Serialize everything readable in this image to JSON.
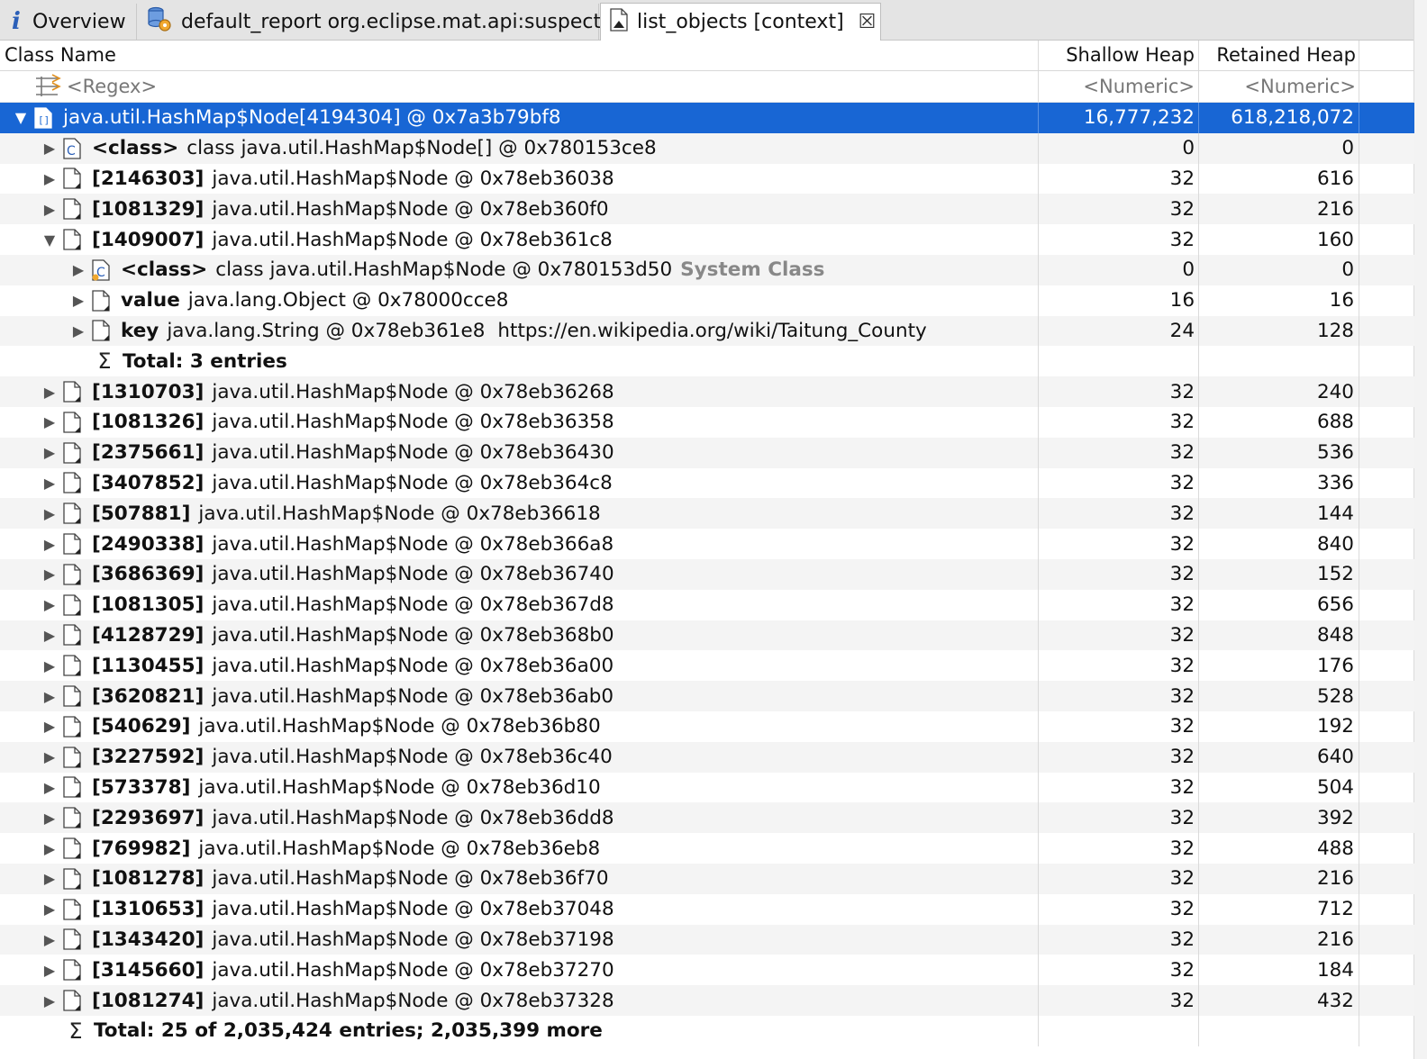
{
  "tabs": [
    {
      "label": "Overview",
      "icon": "info-icon"
    },
    {
      "label": "default_report  org.eclipse.mat.api:suspects",
      "icon": "report-icon"
    },
    {
      "label": "list_objects [context]",
      "icon": "document-icon",
      "close": "☒"
    }
  ],
  "columns": {
    "class_name": "Class Name",
    "shallow": "Shallow Heap",
    "retained": "Retained Heap"
  },
  "filter": {
    "regex": "<Regex>",
    "shallow": "<Numeric>",
    "retained": "<Numeric>"
  },
  "root": {
    "name": "java.util.HashMap$Node[4194304] @ 0x7a3b79bf8",
    "shallow": "16,777,232",
    "retained": "618,218,072"
  },
  "class_row": {
    "bold": "<class>",
    "text": "class java.util.HashMap$Node[] @ 0x780153ce8",
    "shallow": "0",
    "retained": "0"
  },
  "rows_before": [
    {
      "idx": "[2146303]",
      "text": "java.util.HashMap$Node @ 0x78eb36038",
      "shallow": "32",
      "retained": "616"
    },
    {
      "idx": "[1081329]",
      "text": "java.util.HashMap$Node @ 0x78eb360f0",
      "shallow": "32",
      "retained": "216"
    }
  ],
  "expanded": {
    "idx": "[1409007]",
    "text": "java.util.HashMap$Node @ 0x78eb361c8",
    "shallow": "32",
    "retained": "160"
  },
  "children": [
    {
      "bold": "<class>",
      "text": "class java.util.HashMap$Node @ 0x780153d50",
      "extra": "System Class",
      "shallow": "0",
      "retained": "0"
    },
    {
      "bold": "value",
      "text": "java.lang.Object @ 0x78000cce8",
      "extra": "",
      "shallow": "16",
      "retained": "16"
    },
    {
      "bold": "key",
      "text": "java.lang.String @ 0x78eb361e8",
      "extra": "https://en.wikipedia.org/wiki/Taitung_County",
      "shallow": "24",
      "retained": "128"
    }
  ],
  "child_total": "Total: 3 entries",
  "rows_after": [
    {
      "idx": "[1310703]",
      "text": "java.util.HashMap$Node @ 0x78eb36268",
      "shallow": "32",
      "retained": "240"
    },
    {
      "idx": "[1081326]",
      "text": "java.util.HashMap$Node @ 0x78eb36358",
      "shallow": "32",
      "retained": "688"
    },
    {
      "idx": "[2375661]",
      "text": "java.util.HashMap$Node @ 0x78eb36430",
      "shallow": "32",
      "retained": "536"
    },
    {
      "idx": "[3407852]",
      "text": "java.util.HashMap$Node @ 0x78eb364c8",
      "shallow": "32",
      "retained": "336"
    },
    {
      "idx": "[507881]",
      "text": "java.util.HashMap$Node @ 0x78eb36618",
      "shallow": "32",
      "retained": "144"
    },
    {
      "idx": "[2490338]",
      "text": "java.util.HashMap$Node @ 0x78eb366a8",
      "shallow": "32",
      "retained": "840"
    },
    {
      "idx": "[3686369]",
      "text": "java.util.HashMap$Node @ 0x78eb36740",
      "shallow": "32",
      "retained": "152"
    },
    {
      "idx": "[1081305]",
      "text": "java.util.HashMap$Node @ 0x78eb367d8",
      "shallow": "32",
      "retained": "656"
    },
    {
      "idx": "[4128729]",
      "text": "java.util.HashMap$Node @ 0x78eb368b0",
      "shallow": "32",
      "retained": "848"
    },
    {
      "idx": "[1130455]",
      "text": "java.util.HashMap$Node @ 0x78eb36a00",
      "shallow": "32",
      "retained": "176"
    },
    {
      "idx": "[3620821]",
      "text": "java.util.HashMap$Node @ 0x78eb36ab0",
      "shallow": "32",
      "retained": "528"
    },
    {
      "idx": "[540629]",
      "text": "java.util.HashMap$Node @ 0x78eb36b80",
      "shallow": "32",
      "retained": "192"
    },
    {
      "idx": "[3227592]",
      "text": "java.util.HashMap$Node @ 0x78eb36c40",
      "shallow": "32",
      "retained": "640"
    },
    {
      "idx": "[573378]",
      "text": "java.util.HashMap$Node @ 0x78eb36d10",
      "shallow": "32",
      "retained": "504"
    },
    {
      "idx": "[2293697]",
      "text": "java.util.HashMap$Node @ 0x78eb36dd8",
      "shallow": "32",
      "retained": "392"
    },
    {
      "idx": "[769982]",
      "text": "java.util.HashMap$Node @ 0x78eb36eb8",
      "shallow": "32",
      "retained": "488"
    },
    {
      "idx": "[1081278]",
      "text": "java.util.HashMap$Node @ 0x78eb36f70",
      "shallow": "32",
      "retained": "216"
    },
    {
      "idx": "[1310653]",
      "text": "java.util.HashMap$Node @ 0x78eb37048",
      "shallow": "32",
      "retained": "712"
    },
    {
      "idx": "[1343420]",
      "text": "java.util.HashMap$Node @ 0x78eb37198",
      "shallow": "32",
      "retained": "216"
    },
    {
      "idx": "[3145660]",
      "text": "java.util.HashMap$Node @ 0x78eb37270",
      "shallow": "32",
      "retained": "184"
    },
    {
      "idx": "[1081274]",
      "text": "java.util.HashMap$Node @ 0x78eb37328",
      "shallow": "32",
      "retained": "432"
    }
  ],
  "grand_total": "Total: 25 of 2,035,424 entries; 2,035,399 more",
  "colors": {
    "selection": "#1866d4",
    "alt_row": "#f4f4f4"
  }
}
